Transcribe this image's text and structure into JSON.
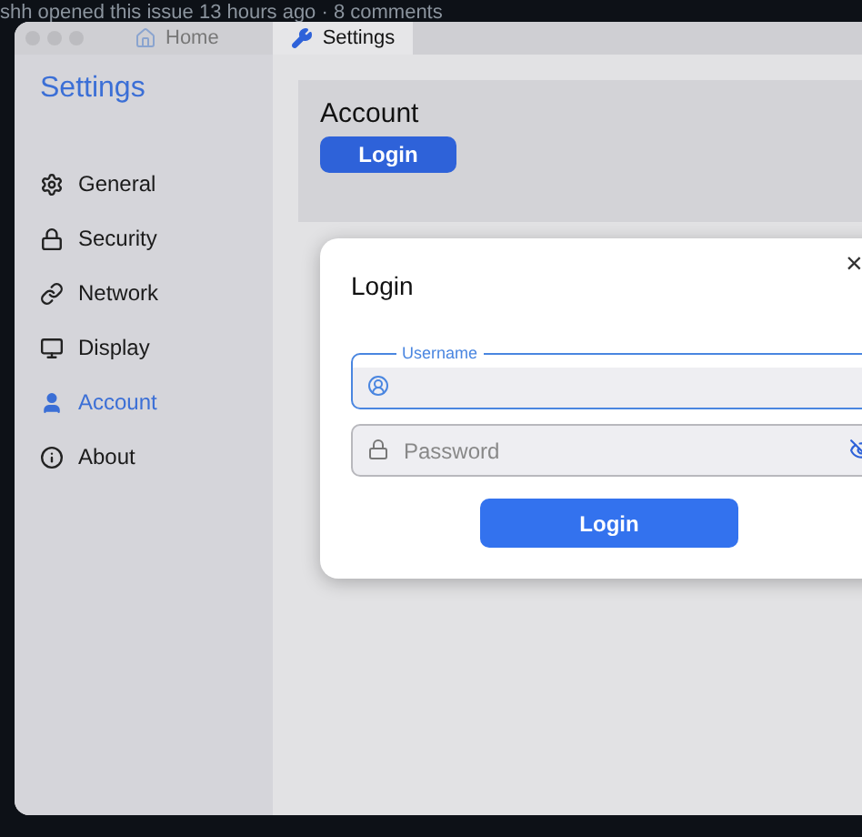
{
  "background_text": "shh opened this issue 13 hours ago · 8 comments",
  "tabs": [
    {
      "label": "Home",
      "selected": false
    },
    {
      "label": "Settings",
      "selected": true
    }
  ],
  "sidebar": {
    "title": "Settings",
    "items": [
      {
        "label": "General",
        "selected": false
      },
      {
        "label": "Security",
        "selected": false
      },
      {
        "label": "Network",
        "selected": false
      },
      {
        "label": "Display",
        "selected": false
      },
      {
        "label": "Account",
        "selected": true
      },
      {
        "label": "About",
        "selected": false
      }
    ]
  },
  "account": {
    "title": "Account",
    "button": "Login"
  },
  "dialog": {
    "title": "Login",
    "close": "×",
    "username": {
      "label": "Username",
      "focused": true
    },
    "password": {
      "placeholder": "Password"
    },
    "button": "Login"
  }
}
